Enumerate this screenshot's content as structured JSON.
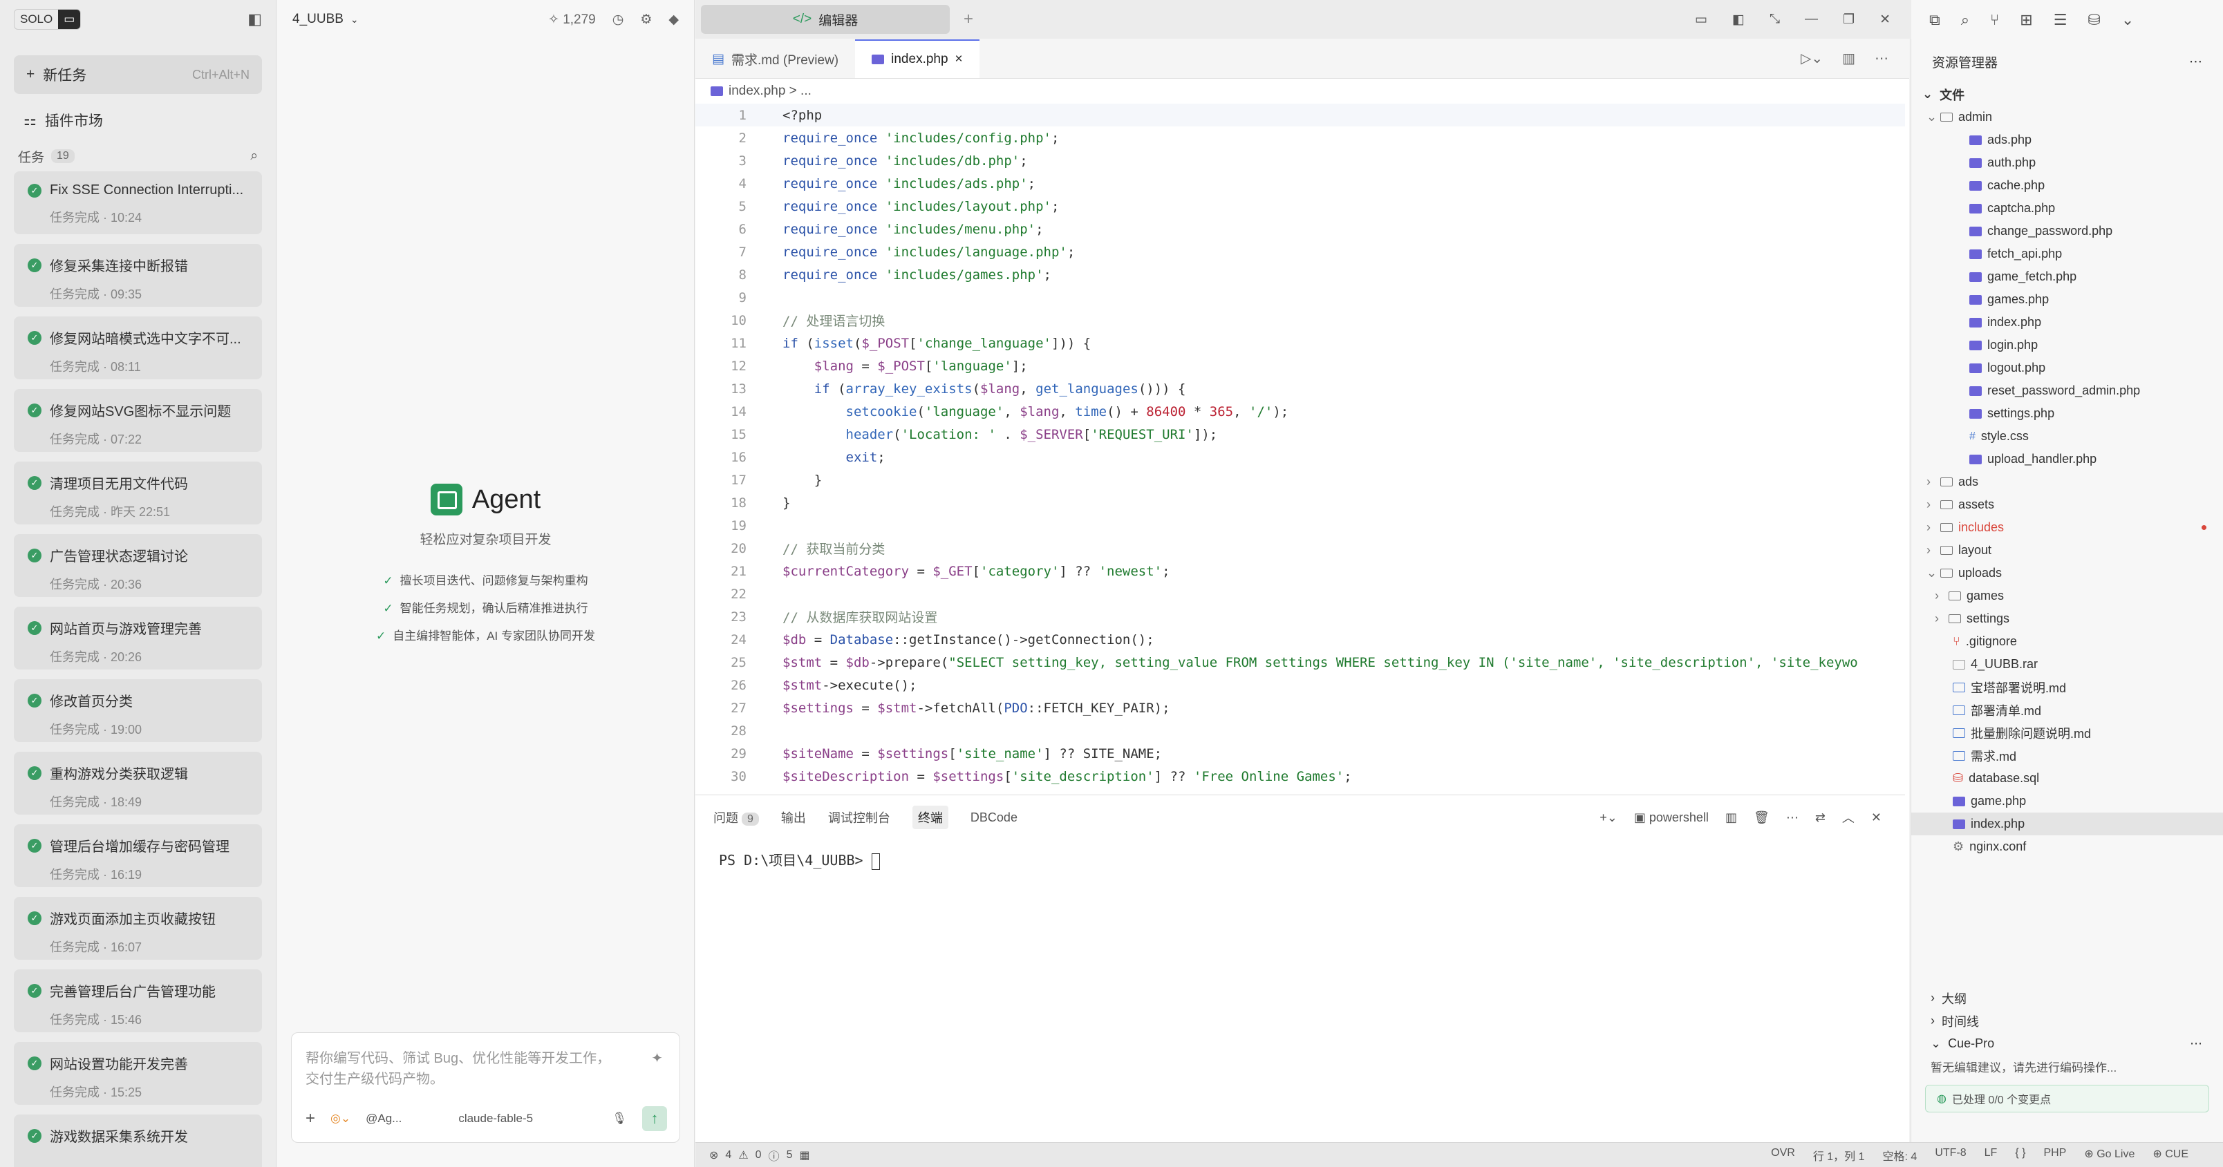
{
  "left": {
    "solo_label": "SOLO",
    "new_task": "新任务",
    "new_task_shortcut": "Ctrl+Alt+N",
    "plugin_market": "插件市场",
    "tasks_label": "任务",
    "tasks_count": "19",
    "tasks": [
      {
        "title": "Fix SSE Connection Interrupti...",
        "sub": "任务完成 · 10:24"
      },
      {
        "title": "修复采集连接中断报错",
        "sub": "任务完成 · 09:35"
      },
      {
        "title": "修复网站暗模式选中文字不可...",
        "sub": "任务完成 · 08:11"
      },
      {
        "title": "修复网站SVG图标不显示问题",
        "sub": "任务完成 · 07:22"
      },
      {
        "title": "清理项目无用文件代码",
        "sub": "任务完成 · 昨天 22:51"
      },
      {
        "title": "广告管理状态逻辑讨论",
        "sub": "任务完成 · 20:36"
      },
      {
        "title": "网站首页与游戏管理完善",
        "sub": "任务完成 · 20:26"
      },
      {
        "title": "修改首页分类",
        "sub": "任务完成 · 19:00"
      },
      {
        "title": "重构游戏分类获取逻辑",
        "sub": "任务完成 · 18:49"
      },
      {
        "title": "管理后台增加缓存与密码管理",
        "sub": "任务完成 · 16:19"
      },
      {
        "title": "游戏页面添加主页收藏按钮",
        "sub": "任务完成 · 16:07"
      },
      {
        "title": "完善管理后台广告管理功能",
        "sub": "任务完成 · 15:46"
      },
      {
        "title": "网站设置功能开发完善",
        "sub": "任务完成 · 15:25"
      },
      {
        "title": "游戏数据采集系统开发",
        "sub": ""
      }
    ]
  },
  "agent": {
    "project": "4_UUBB",
    "stars": "1,279",
    "title": "Agent",
    "subtitle": "轻松应对复杂项目开发",
    "features": [
      "擅长项目迭代、问题修复与架构重构",
      "智能任务规划，确认后精准推进执行",
      "自主编排智能体，AI 专家团队协同开发"
    ],
    "composer_placeholder": "帮你编写代码、筛试 Bug、优化性能等开发工作，交付生产级代码产物。",
    "agent_select": "@Ag...",
    "model": "claude-fable-5"
  },
  "editor": {
    "window_tab": "编辑器",
    "tabs": [
      "需求.md (Preview)",
      "index.php"
    ],
    "breadcrumb": "index.php > ...",
    "panel_tabs": [
      "问题",
      "输出",
      "调试控制台",
      "终端",
      "DBCode"
    ],
    "problems_count": "9",
    "shell": "powershell",
    "prompt": "PS D:\\项目\\4_UUBB> "
  },
  "code_lines": [
    "<?php",
    "require_once 'includes/config.php';",
    "require_once 'includes/db.php';",
    "require_once 'includes/ads.php';",
    "require_once 'includes/layout.php';",
    "require_once 'includes/menu.php';",
    "require_once 'includes/language.php';",
    "require_once 'includes/games.php';",
    "",
    "// 处理语言切换",
    "if (isset($_POST['change_language'])) {",
    "    $lang = $_POST['language'];",
    "    if (array_key_exists($lang, get_languages())) {",
    "        setcookie('language', $lang, time() + 86400 * 365, '/');",
    "        header('Location: ' . $_SERVER['REQUEST_URI']);",
    "        exit;",
    "    }",
    "}",
    "",
    "// 获取当前分类",
    "$currentCategory = $_GET['category'] ?? 'newest';",
    "",
    "// 从数据库获取网站设置",
    "$db = Database::getInstance()->getConnection();",
    "$stmt = $db->prepare(\"SELECT setting_key, setting_value FROM settings WHERE setting_key IN ('site_name', 'site_description', 'site_keywo",
    "$stmt->execute();",
    "$settings = $stmt->fetchAll(PDO::FETCH_KEY_PAIR);",
    "",
    "$siteName = $settings['site_name'] ?? SITE_NAME;",
    "$siteDescription = $settings['site_description'] ?? 'Free Online Games';"
  ],
  "explorer": {
    "title": "资源管理器",
    "files_label": "文件",
    "tree": [
      {
        "name": "admin",
        "type": "folder-open",
        "depth": 0
      },
      {
        "name": "ads.php",
        "type": "php",
        "depth": 2
      },
      {
        "name": "auth.php",
        "type": "php",
        "depth": 2
      },
      {
        "name": "cache.php",
        "type": "php",
        "depth": 2
      },
      {
        "name": "captcha.php",
        "type": "php",
        "depth": 2
      },
      {
        "name": "change_password.php",
        "type": "php",
        "depth": 2
      },
      {
        "name": "fetch_api.php",
        "type": "php",
        "depth": 2
      },
      {
        "name": "game_fetch.php",
        "type": "php",
        "depth": 2
      },
      {
        "name": "games.php",
        "type": "php",
        "depth": 2
      },
      {
        "name": "index.php",
        "type": "php",
        "depth": 2
      },
      {
        "name": "login.php",
        "type": "php",
        "depth": 2
      },
      {
        "name": "logout.php",
        "type": "php",
        "depth": 2
      },
      {
        "name": "reset_password_admin.php",
        "type": "php",
        "depth": 2
      },
      {
        "name": "settings.php",
        "type": "php",
        "depth": 2
      },
      {
        "name": "style.css",
        "type": "css",
        "depth": 2
      },
      {
        "name": "upload_handler.php",
        "type": "php",
        "depth": 2
      },
      {
        "name": "ads",
        "type": "folder",
        "depth": 0
      },
      {
        "name": "assets",
        "type": "folder",
        "depth": 0
      },
      {
        "name": "includes",
        "type": "folder",
        "depth": 0,
        "color": "#d9463b"
      },
      {
        "name": "layout",
        "type": "folder",
        "depth": 0
      },
      {
        "name": "uploads",
        "type": "folder-open",
        "depth": 0
      },
      {
        "name": "games",
        "type": "folder",
        "depth": 1
      },
      {
        "name": "settings",
        "type": "folder",
        "depth": 1
      },
      {
        "name": ".gitignore",
        "type": "git",
        "depth": 0
      },
      {
        "name": "4_UUBB.rar",
        "type": "file",
        "depth": 0
      },
      {
        "name": "宝塔部署说明.md",
        "type": "md",
        "depth": 0
      },
      {
        "name": "部署清单.md",
        "type": "md",
        "depth": 0
      },
      {
        "name": "批量删除问题说明.md",
        "type": "md",
        "depth": 0
      },
      {
        "name": "需求.md",
        "type": "md",
        "depth": 0
      },
      {
        "name": "database.sql",
        "type": "db",
        "depth": 0
      },
      {
        "name": "game.php",
        "type": "php",
        "depth": 0
      },
      {
        "name": "index.php",
        "type": "php",
        "depth": 0,
        "active": true
      },
      {
        "name": "nginx.conf",
        "type": "gear",
        "depth": 0
      }
    ],
    "outline": "大纲",
    "timeline": "时间线",
    "cue_title": "Cue-Pro",
    "cue_text": "暂无编辑建议，请先进行编码操作...",
    "cue_status": "已处理 0/0 个变更点"
  },
  "status": {
    "errors": "4",
    "warnings": "0",
    "infos": "5",
    "items": [
      "OVR",
      "行 1，列 1",
      "空格: 4",
      "UTF-8",
      "LF",
      "{ }",
      "PHP",
      "⊕ Go Live",
      "⊕ CUE"
    ]
  }
}
